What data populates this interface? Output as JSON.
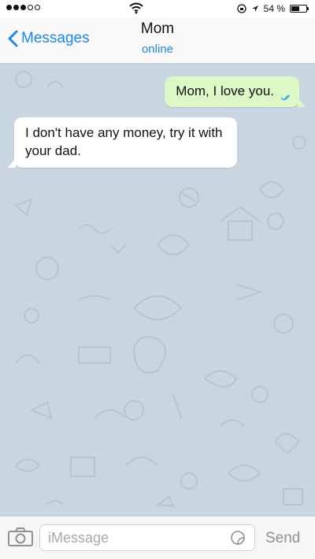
{
  "status_bar": {
    "battery_percent": "54 %",
    "battery_level": 0.54,
    "signal_bars_filled": 3,
    "signal_bars_total": 5
  },
  "nav": {
    "back_label": "Messages",
    "title": "Mom",
    "subtitle": "online"
  },
  "messages": [
    {
      "direction": "outgoing",
      "text": "Mom, I love you.",
      "status": "read"
    },
    {
      "direction": "incoming",
      "text": "I don't have any money, try it with your dad."
    }
  ],
  "input_bar": {
    "placeholder": "iMessage",
    "value": "",
    "send_label": "Send"
  },
  "colors": {
    "accent": "#1e88e5",
    "chat_background": "#c9d6e2",
    "outgoing_bubble": "#dcf8c6",
    "incoming_bubble": "#ffffff",
    "read_ticks": "#4fa3e8"
  },
  "icons": [
    "wifi-icon",
    "location-arrow-icon",
    "battery-icon",
    "chevron-left-icon",
    "double-check-icon",
    "camera-icon",
    "sticker-icon"
  ]
}
